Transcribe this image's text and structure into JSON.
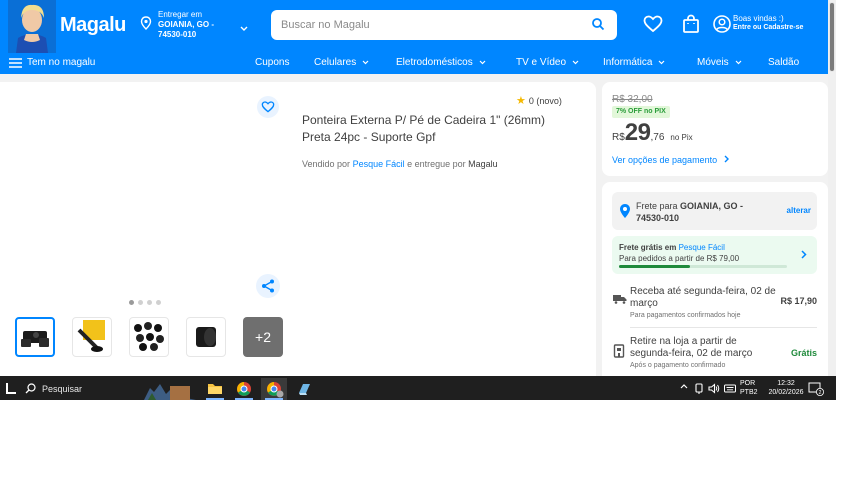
{
  "header": {
    "logo": "Magalu",
    "delivery": {
      "label": "Entregar em",
      "city": "GOIANIA, GO -",
      "zip": "74530-010"
    },
    "search": {
      "placeholder": "Buscar no Magalu"
    },
    "user": {
      "greeting": "Boas vindas :)",
      "action": "Entre ou Cadastre-se"
    }
  },
  "nav": {
    "menu_label": "Tem no magalu",
    "items": [
      {
        "label": "Cupons",
        "has_dropdown": false
      },
      {
        "label": "Celulares",
        "has_dropdown": true
      },
      {
        "label": "Eletrodomésticos",
        "has_dropdown": true
      },
      {
        "label": "TV e Vídeo",
        "has_dropdown": true
      },
      {
        "label": "Informática",
        "has_dropdown": true
      },
      {
        "label": "Móveis",
        "has_dropdown": true
      },
      {
        "label": "Saldão",
        "has_dropdown": false
      }
    ]
  },
  "product": {
    "title": "Ponteira Externa P/ Pé de Cadeira 1\" (26mm) Preta 24pc - Suporte Gpf",
    "rating": "0 (novo)",
    "seller_prefix": "Vendido por",
    "seller": "Pesque Fácil",
    "seller_middle": "e entregue por",
    "delivered_by": "Magalu",
    "carousel_dots": 4,
    "carousel_active": 0,
    "thumbnails": [
      "thumb-1",
      "thumb-2",
      "thumb-3",
      "thumb-4"
    ],
    "more_images": "+2"
  },
  "price": {
    "old": "R$ 32,00",
    "discount": "7% OFF no PIX",
    "currency": "R$",
    "integer": "29",
    "cents": ",76",
    "method": "no Pix",
    "payment_link": "Ver opções de pagamento"
  },
  "shipping": {
    "freight_label": "Frete para",
    "freight_city": "GOIANIA, GO -",
    "freight_zip": "74530-010",
    "change_label": "alterar",
    "free": {
      "title": "Frete grátis em",
      "store": "Pesque Fácil",
      "subtitle": "Para pedidos a partir de R$ 79,00",
      "progress": 0.42
    },
    "options": [
      {
        "title": "Receba até segunda-feira, 02 de março",
        "subtitle": "Para pagamentos confirmados hoje",
        "price": "R$ 17,90",
        "icon": "truck-icon"
      },
      {
        "title": "Retire na loja a partir de segunda-feira, 02 de março",
        "subtitle": "Após o pagamento confirmado",
        "price": "Grátis",
        "icon": "store-icon"
      }
    ]
  },
  "taskbar": {
    "search_label": "Pesquisar",
    "lang_line1": "POR",
    "lang_line2": "PTB2",
    "time": "12:32",
    "date": "20/02/2026",
    "notifications": "2"
  },
  "colors": {
    "brand": "#0086ff",
    "green": "#1f8a3b",
    "star": "#f5b900"
  }
}
